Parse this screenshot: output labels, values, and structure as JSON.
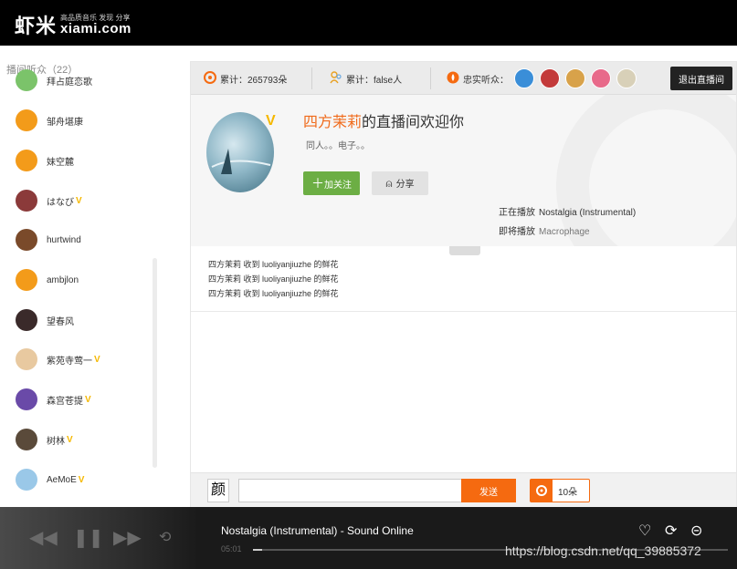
{
  "brand": {
    "logo_cn": "虾米",
    "tagline": "高品质音乐 发现 分享",
    "logo_en": "xiami.com"
  },
  "sidebar": {
    "title": "播间听众（22）",
    "listeners": [
      {
        "name": "拜占庭恋歌",
        "vip": false,
        "color": "#7bc36a"
      },
      {
        "name": "邹舟堪康",
        "vip": false,
        "color": "#f39b1a"
      },
      {
        "name": "妹空麓",
        "vip": false,
        "color": "#f39b1a"
      },
      {
        "name": "はなび",
        "vip": true,
        "color": "#8b3a3a"
      },
      {
        "name": "hurtwind",
        "vip": false,
        "color": "#7a4a2a"
      },
      {
        "name": "ambjlon",
        "vip": false,
        "color": "#f39b1a"
      },
      {
        "name": "望春风",
        "vip": false,
        "color": "#3a2a2a"
      },
      {
        "name": "紫苑寺莺一",
        "vip": true,
        "color": "#e8c9a0"
      },
      {
        "name": "森宫苍提",
        "vip": true,
        "color": "#6a4aa8"
      },
      {
        "name": "树林",
        "vip": true,
        "color": "#5a4a3a"
      },
      {
        "name": "AeMoE",
        "vip": true,
        "color": "#9ac8e8"
      }
    ],
    "vip_mark": "V"
  },
  "stats": {
    "total_plays": "累计：265793朵",
    "total_people": "累计：false人",
    "loyal_label": "忠实听众：",
    "exit_label": "退出直播间",
    "fan_colors": [
      "#3a8ed8",
      "#c33a3a",
      "#d8a24a",
      "#e86a8a",
      "#d8d0b8"
    ]
  },
  "room": {
    "host": "四方茉莉",
    "title_suffix": "的直播间欢迎你",
    "tags": "同人。。电子。。",
    "follow_label": "加关注",
    "share_label": "分享",
    "now_label": "正在播放",
    "now_song": "Nostalgia (Instrumental)",
    "next_label": "即将播放",
    "next_song": "Macrophage",
    "vip_mark": "V"
  },
  "messages": [
    "四方茉莉 收到 luoliyanjiuzhe 的鲜花",
    "四方茉莉 收到 luoliyanjiuzhe 的鲜花",
    "四方茉莉 收到 luoliyanjiuzhe 的鲜花"
  ],
  "composer": {
    "face_label": "颜",
    "input_value": "",
    "send_label": "发送",
    "flower_count": "10朵"
  },
  "player": {
    "track": "Nostalgia (Instrumental) - Sound Online",
    "time": "05:01",
    "progress": 0.02,
    "watermark": "https://blog.csdn.net/qq_39885372"
  }
}
